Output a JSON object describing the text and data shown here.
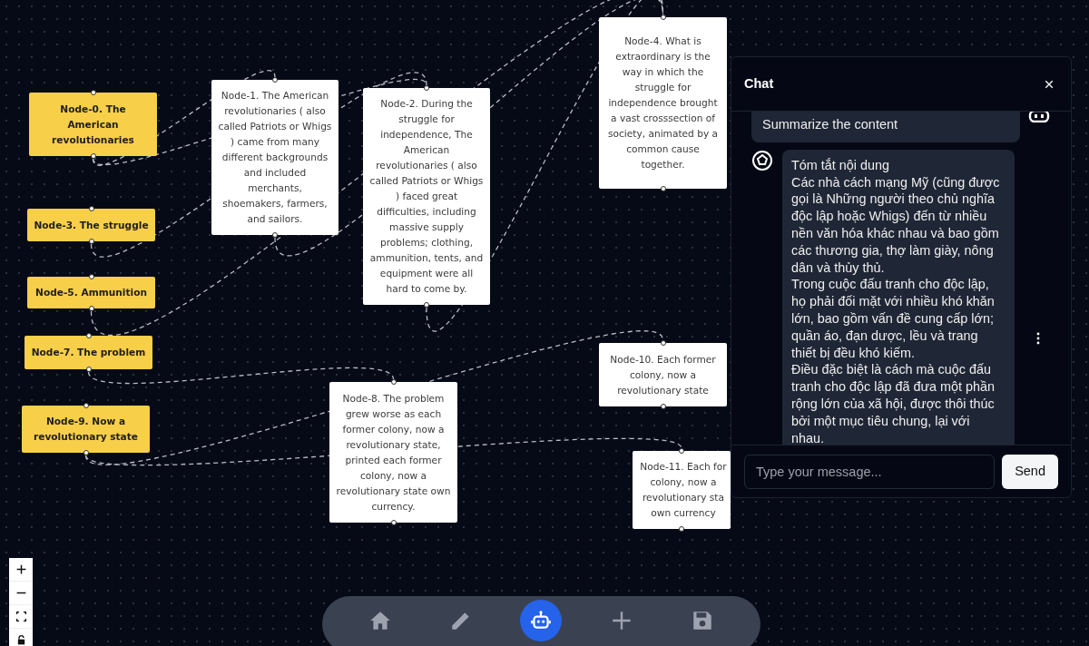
{
  "nodes": [
    {
      "kind": "title",
      "text": "Node-0. The American revolutionaries"
    },
    {
      "kind": "detail",
      "text": "Node-1. The American revolutionaries ( also called Patriots or Whigs ) came from many different backgrounds and included merchants, shoemakers, farmers, and sailors."
    },
    {
      "kind": "detail",
      "text": "Node-2. During the struggle for independence, The American revolutionaries ( also called Patriots or Whigs ) faced great difficulties, including massive supply problems; clothing, ammunition, tents, and equipment were all hard to come by."
    },
    {
      "kind": "title",
      "text": "Node-3. The struggle"
    },
    {
      "kind": "detail",
      "text": "Node-4. What is extraordinary is the way in which the struggle for independence brought a vast crosssection of society, animated by a common cause together."
    },
    {
      "kind": "title",
      "text": "Node-5. Ammunition"
    },
    {
      "kind": "title",
      "text": "Node-7. The problem"
    },
    {
      "kind": "detail",
      "text": "Node-8. The problem grew worse as each former colony, now a revolutionary state, printed each former colony, now a revolutionary state own currency."
    },
    {
      "kind": "title",
      "text": "Node-9. Now a revolutionary state"
    },
    {
      "kind": "detail",
      "text": "Node-10. Each former colony, now a revolutionary state"
    },
    {
      "kind": "detail",
      "lines": [
        "Node-11. Each for",
        "colony, now a",
        "revolutionary sta",
        "own currency"
      ]
    }
  ],
  "zoom_controls": [
    {
      "kind": "zoom-in"
    },
    {
      "kind": "zoom-out"
    },
    {
      "kind": "fit-view"
    },
    {
      "kind": "lock"
    }
  ],
  "toolbar": [
    {
      "kind": "home",
      "selected": false
    },
    {
      "kind": "edit",
      "selected": false
    },
    {
      "kind": "bot",
      "selected": true
    },
    {
      "kind": "add",
      "selected": false
    },
    {
      "kind": "save",
      "selected": false
    }
  ],
  "chat": {
    "title": "Chat",
    "messages": [
      {
        "kind": "user",
        "paragraphs": [
          "Summarize the content"
        ]
      },
      {
        "kind": "bot",
        "paragraphs": [
          "Tóm tắt nội dung",
          "Các nhà cách mạng Mỹ (cũng được gọi là Những người theo chủ nghĩa độc lập hoặc Whigs) đến từ nhiều nền văn hóa khác nhau và bao gồm các thương gia, thợ làm giày, nông dân và thủy thủ.",
          "Trong cuộc đấu tranh cho độc lập, họ phải đối mặt với nhiều khó khăn lớn, bao gồm vấn đề cung cấp lớn; quần áo, đạn dược, lều và trang thiết bị đều khó kiếm.",
          "Điều đặc biệt là cách mà cuộc đấu tranh cho độc lập đã đưa một phần rộng lớn của xã hội, được thôi thúc bởi một mục tiêu chung, lại với nhau."
        ]
      }
    ],
    "input": {
      "placeholder": "Type your message..."
    },
    "send": "Send"
  }
}
